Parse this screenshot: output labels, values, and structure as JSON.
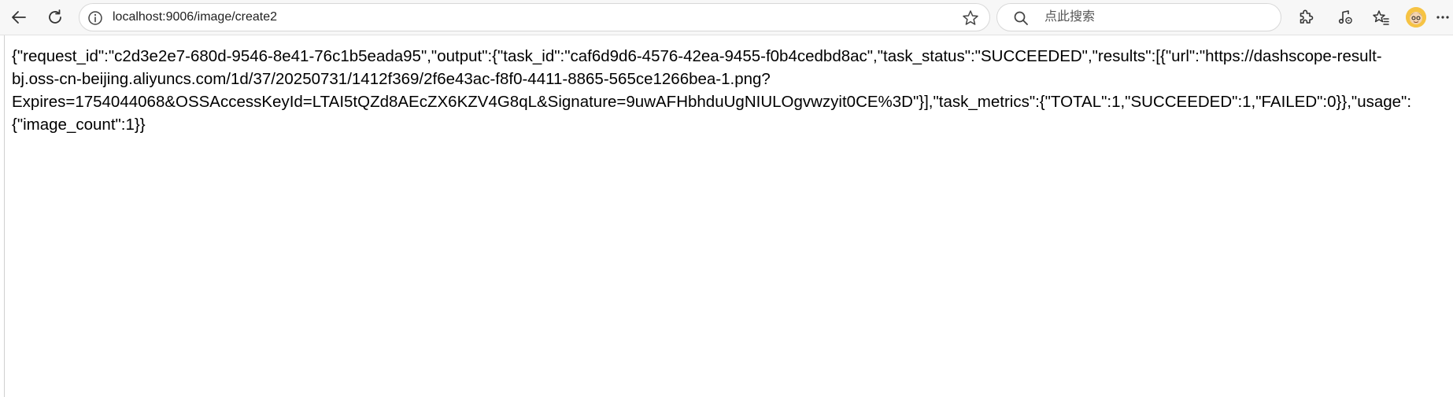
{
  "browser": {
    "address_url": "localhost:9006/image/create2",
    "search_placeholder": "点此搜索"
  },
  "icons": {
    "back": "back-arrow-icon",
    "reload": "reload-icon",
    "site_info": "site-info-icon",
    "favorite": "star-icon",
    "search": "search-icon",
    "extensions": "puzzle-icon",
    "media": "music-note-icon",
    "favorites": "favorites-icon",
    "profile": "avatar",
    "more": "more-icon"
  },
  "page": {
    "body_text": "{\"request_id\":\"c2d3e2e7-680d-9546-8e41-76c1b5eada95\",\"output\":{\"task_id\":\"caf6d9d6-4576-42ea-9455-f0b4cedbd8ac\",\"task_status\":\"SUCCEEDED\",\"results\":[{\"url\":\"https://dashscope-result-\nbj.oss-cn-beijing.aliyuncs.com/1d/37/20250731/1412f369/2f6e43ac-f8f0-4411-8865-565ce1266bea-1.png?\nExpires=1754044068&OSSAccessKeyId=LTAI5tQZd8AEcZX6KZV4G8qL&Signature=9uwAFHbhduUgNIULOgvwzyit0CE%3D\"}],\"task_metrics\":{\"TOTAL\":1,\"SUCCEEDED\":1,\"FAILED\":0}},\"usage\":\n{\"image_count\":1}}"
  },
  "colors": {
    "toolbar_bg": "#f7f7f7",
    "page_bg": "#ffffff",
    "text": "#000000"
  }
}
